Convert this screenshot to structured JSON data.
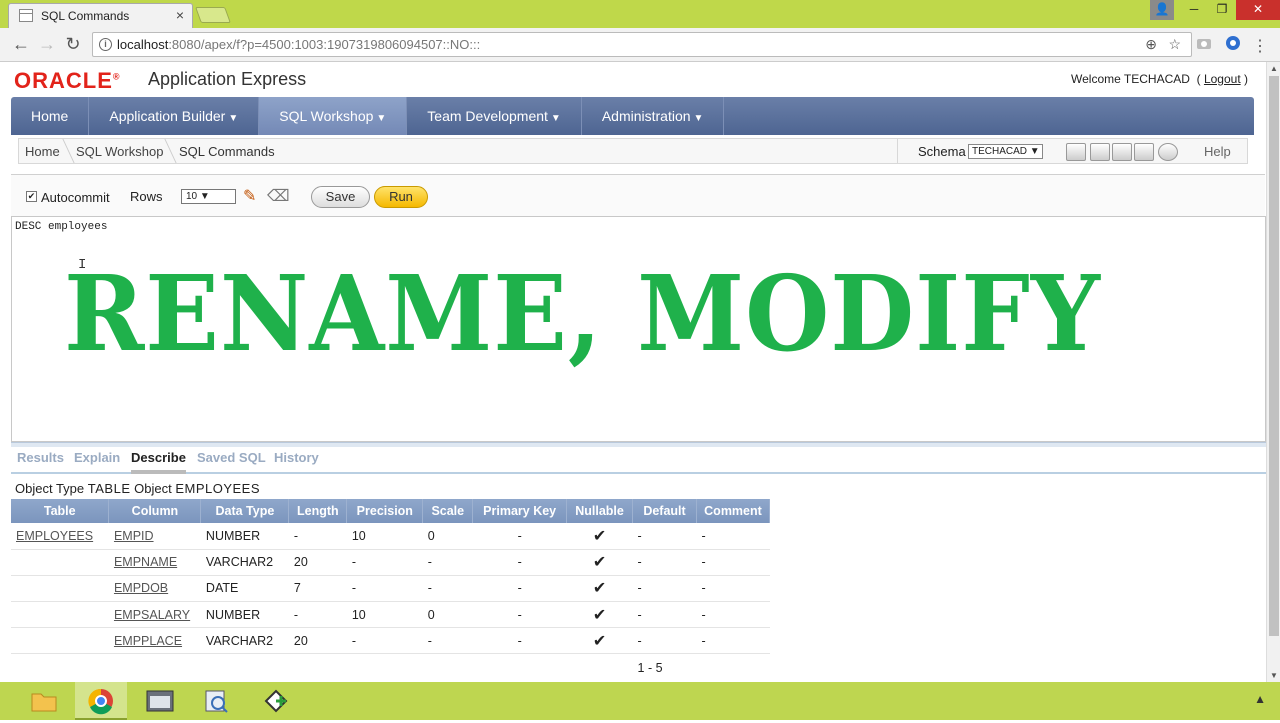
{
  "browser": {
    "tab_title": "SQL Commands",
    "tab_close": "×",
    "url_host": "localhost",
    "url_rest": ":8080/apex/f?p=4500:1003:1907319806094507::NO:::",
    "info_glyph": "i",
    "window_controls": {
      "user": "👤",
      "minimize": "─",
      "maximize": "❐",
      "close": "✕"
    },
    "nav": {
      "back": "←",
      "forward": "→",
      "reload": "↻"
    },
    "zoom_glyph": "⊕",
    "star_glyph": "☆",
    "menu_glyph": "⋮"
  },
  "header": {
    "logo": "ORACLE",
    "logo_mark": "®",
    "product": "Application Express",
    "welcome": "Welcome TECHACAD",
    "logout_open": "(",
    "logout": "Logout",
    "logout_close": ")"
  },
  "main_nav": [
    {
      "label": "Home",
      "caret": ""
    },
    {
      "label": "Application Builder",
      "caret": "▼"
    },
    {
      "label": "SQL Workshop",
      "caret": "▼"
    },
    {
      "label": "Team Development",
      "caret": "▼"
    },
    {
      "label": "Administration",
      "caret": "▼"
    }
  ],
  "breadcrumbs": [
    "Home",
    "SQL Workshop",
    "SQL Commands"
  ],
  "schema": {
    "label": "Schema",
    "value": "TECHACAD ▼"
  },
  "help_label": "Help",
  "command_bar": {
    "autocommit_checked": "✔",
    "autocommit_label": "Autocommit",
    "rows_label": "Rows",
    "rows_value": "10 ▼",
    "save_label": "Save",
    "run_label": "Run",
    "pencil_icon": "✎",
    "eraser_icon": "⌫"
  },
  "editor": {
    "code": "DESC employees",
    "cursor": "I"
  },
  "overlay_text": "RENAME, MODIFY",
  "result_tabs": [
    "Results",
    "Explain",
    "Describe",
    "Saved SQL",
    "History"
  ],
  "object_info": {
    "type_label": "Object Type",
    "type_value": "TABLE",
    "object_label": "Object",
    "object_value": "EMPLOYEES"
  },
  "describe_table": {
    "headers": [
      "Table",
      "Column",
      "Data Type",
      "Length",
      "Precision",
      "Scale",
      "Primary Key",
      "Nullable",
      "Default",
      "Comment"
    ],
    "rows": [
      {
        "table": "EMPLOYEES",
        "column": "EMPID",
        "type": "NUMBER",
        "length": "-",
        "precision": "10",
        "scale": "0",
        "pk": "-",
        "nullable": "✔",
        "default": "-",
        "comment": "-"
      },
      {
        "table": "",
        "column": "EMPNAME",
        "type": "VARCHAR2",
        "length": "20",
        "precision": "-",
        "scale": "-",
        "pk": "-",
        "nullable": "✔",
        "default": "-",
        "comment": "-"
      },
      {
        "table": "",
        "column": "EMPDOB",
        "type": "DATE",
        "length": "7",
        "precision": "-",
        "scale": "-",
        "pk": "-",
        "nullable": "✔",
        "default": "-",
        "comment": "-"
      },
      {
        "table": "",
        "column": "EMPSALARY",
        "type": "NUMBER",
        "length": "-",
        "precision": "10",
        "scale": "0",
        "pk": "-",
        "nullable": "✔",
        "default": "-",
        "comment": "-"
      },
      {
        "table": "",
        "column": "EMPPLACE",
        "type": "VARCHAR2",
        "length": "20",
        "precision": "-",
        "scale": "-",
        "pk": "-",
        "nullable": "✔",
        "default": "-",
        "comment": "-"
      }
    ],
    "pagination": "1 - 5"
  },
  "taskbar": {
    "items": [
      "folder-icon",
      "chrome-icon",
      "window-icon",
      "search-doc-icon",
      "tool-icon"
    ],
    "tray_glyph": "▲"
  },
  "colors": {
    "overlay": "#1fb14b",
    "oracle_red": "#e2231a",
    "chrome_accent": "#bfd84a",
    "nav_blue": "#4e6592"
  }
}
